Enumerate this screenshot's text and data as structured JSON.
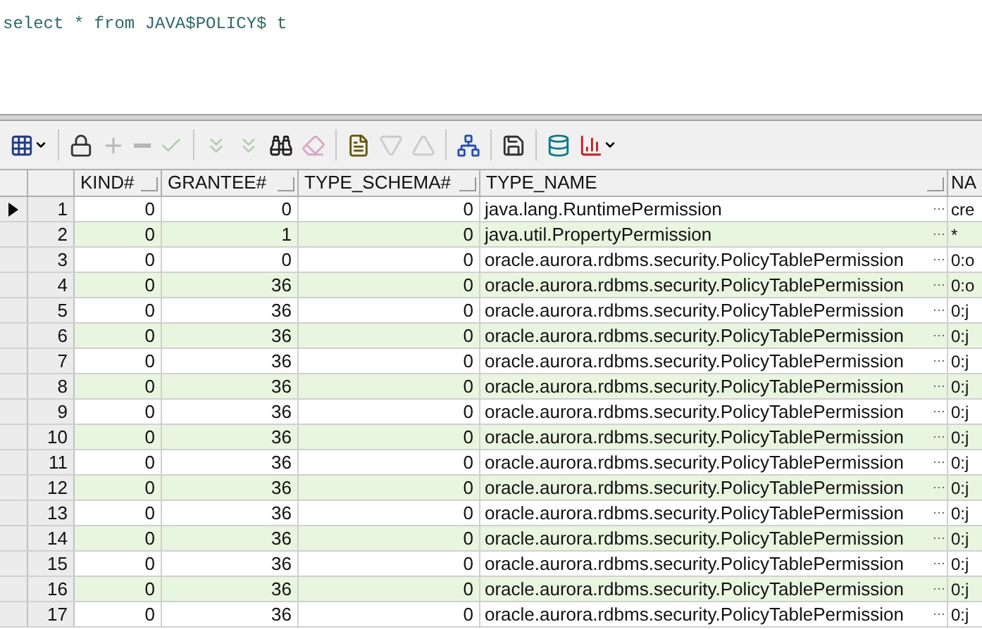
{
  "editor": {
    "sql": "select * from JAVA$POLICY$ t"
  },
  "toolbar": {
    "buttons": [
      {
        "kind": "grid",
        "disabled": false
      },
      {
        "kind": "sep"
      },
      {
        "kind": "lock",
        "disabled": false
      },
      {
        "kind": "plus",
        "disabled": true
      },
      {
        "kind": "minus",
        "disabled": true
      },
      {
        "kind": "check",
        "disabled": true
      },
      {
        "kind": "sep"
      },
      {
        "kind": "down",
        "disabled": true
      },
      {
        "kind": "downlast",
        "disabled": true
      },
      {
        "kind": "find",
        "disabled": false
      },
      {
        "kind": "eraser",
        "disabled": true
      },
      {
        "kind": "sep"
      },
      {
        "kind": "query",
        "disabled": false
      },
      {
        "kind": "tridown",
        "disabled": true
      },
      {
        "kind": "triup",
        "disabled": true
      },
      {
        "kind": "sep"
      },
      {
        "kind": "tree",
        "disabled": false
      },
      {
        "kind": "sep"
      },
      {
        "kind": "save",
        "disabled": false
      },
      {
        "kind": "sep"
      },
      {
        "kind": "db",
        "disabled": false
      },
      {
        "kind": "chart",
        "disabled": false
      }
    ]
  },
  "table": {
    "columns": [
      "KIND#",
      "GRANTEE#",
      "TYPE_SCHEMA#",
      "TYPE_NAME",
      "NA"
    ],
    "rows": [
      {
        "num": "1",
        "selected": true,
        "cells": [
          "0",
          "0",
          "0",
          "java.lang.RuntimePermission",
          "cre"
        ]
      },
      {
        "num": "2",
        "selected": false,
        "cells": [
          "0",
          "1",
          "0",
          "java.util.PropertyPermission",
          "*"
        ]
      },
      {
        "num": "3",
        "selected": false,
        "cells": [
          "0",
          "0",
          "0",
          "oracle.aurora.rdbms.security.PolicyTablePermission",
          "0:o"
        ]
      },
      {
        "num": "4",
        "selected": false,
        "cells": [
          "0",
          "36",
          "0",
          "oracle.aurora.rdbms.security.PolicyTablePermission",
          "0:o"
        ]
      },
      {
        "num": "5",
        "selected": false,
        "cells": [
          "0",
          "36",
          "0",
          "oracle.aurora.rdbms.security.PolicyTablePermission",
          "0:j"
        ]
      },
      {
        "num": "6",
        "selected": false,
        "cells": [
          "0",
          "36",
          "0",
          "oracle.aurora.rdbms.security.PolicyTablePermission",
          "0:j"
        ]
      },
      {
        "num": "7",
        "selected": false,
        "cells": [
          "0",
          "36",
          "0",
          "oracle.aurora.rdbms.security.PolicyTablePermission",
          "0:j"
        ]
      },
      {
        "num": "8",
        "selected": false,
        "cells": [
          "0",
          "36",
          "0",
          "oracle.aurora.rdbms.security.PolicyTablePermission",
          "0:j"
        ]
      },
      {
        "num": "9",
        "selected": false,
        "cells": [
          "0",
          "36",
          "0",
          "oracle.aurora.rdbms.security.PolicyTablePermission",
          "0:j"
        ]
      },
      {
        "num": "10",
        "selected": false,
        "cells": [
          "0",
          "36",
          "0",
          "oracle.aurora.rdbms.security.PolicyTablePermission",
          "0:j"
        ]
      },
      {
        "num": "11",
        "selected": false,
        "cells": [
          "0",
          "36",
          "0",
          "oracle.aurora.rdbms.security.PolicyTablePermission",
          "0:j"
        ]
      },
      {
        "num": "12",
        "selected": false,
        "cells": [
          "0",
          "36",
          "0",
          "oracle.aurora.rdbms.security.PolicyTablePermission",
          "0:j"
        ]
      },
      {
        "num": "13",
        "selected": false,
        "cells": [
          "0",
          "36",
          "0",
          "oracle.aurora.rdbms.security.PolicyTablePermission",
          "0:j"
        ]
      },
      {
        "num": "14",
        "selected": false,
        "cells": [
          "0",
          "36",
          "0",
          "oracle.aurora.rdbms.security.PolicyTablePermission",
          "0:j"
        ]
      },
      {
        "num": "15",
        "selected": false,
        "cells": [
          "0",
          "36",
          "0",
          "oracle.aurora.rdbms.security.PolicyTablePermission",
          "0:j"
        ]
      },
      {
        "num": "16",
        "selected": false,
        "cells": [
          "0",
          "36",
          "0",
          "oracle.aurora.rdbms.security.PolicyTablePermission",
          "0:j"
        ]
      },
      {
        "num": "17",
        "selected": false,
        "cells": [
          "0",
          "36",
          "0",
          "oracle.aurora.rdbms.security.PolicyTablePermission",
          "0:j"
        ]
      }
    ]
  }
}
